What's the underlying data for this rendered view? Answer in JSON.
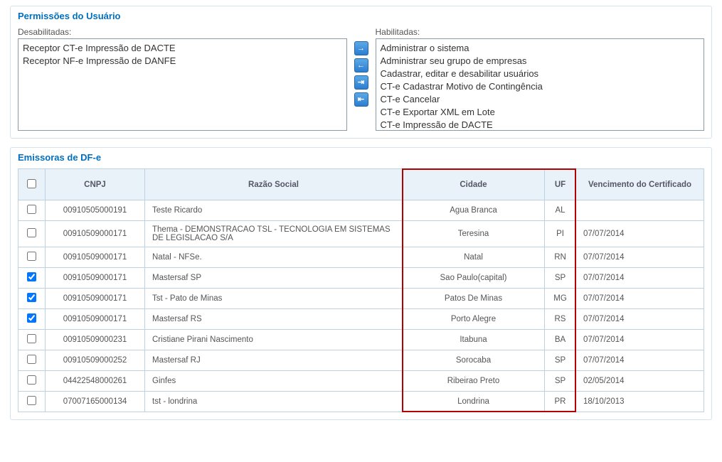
{
  "permissions": {
    "title": "Permissões do Usuário",
    "disabled_label": "Desabilitadas:",
    "enabled_label": "Habilitadas:",
    "disabled_items": [
      "Receptor CT-e Impressão de DACTE",
      "Receptor NF-e Impressão de DANFE"
    ],
    "enabled_items": [
      "Administrar o sistema",
      "Administrar seu grupo de empresas",
      "Cadastrar, editar e desabilitar usuários",
      "CT-e Cadastrar Motivo de Contingência",
      "CT-e Cancelar",
      "CT-e Exportar XML em Lote",
      "CT-e Impressão de DACTE"
    ],
    "arrows": {
      "right": "→",
      "left": "←",
      "right_all": "⇥",
      "left_all": "⇤"
    }
  },
  "emitters": {
    "title": "Emissoras de DF-e",
    "headers": {
      "cnpj": "CNPJ",
      "razao": "Razão Social",
      "cidade": "Cidade",
      "uf": "UF",
      "venc": "Vencimento do Certificado"
    },
    "rows": [
      {
        "checked": false,
        "cnpj": "00910505000191",
        "razao": "Teste Ricardo",
        "cidade": "Agua Branca",
        "uf": "AL",
        "venc": ""
      },
      {
        "checked": false,
        "cnpj": "00910509000171",
        "razao": "Thema - DEMONSTRACAO TSL - TECNOLOGIA EM SISTEMAS DE LEGISLACAO S/A",
        "cidade": "Teresina",
        "uf": "PI",
        "venc": "07/07/2014"
      },
      {
        "checked": false,
        "cnpj": "00910509000171",
        "razao": "Natal - NFSe.",
        "cidade": "Natal",
        "uf": "RN",
        "venc": "07/07/2014"
      },
      {
        "checked": true,
        "cnpj": "00910509000171",
        "razao": "Mastersaf SP",
        "cidade": "Sao Paulo(capital)",
        "uf": "SP",
        "venc": "07/07/2014"
      },
      {
        "checked": true,
        "cnpj": "00910509000171",
        "razao": "Tst - Pato de Minas",
        "cidade": "Patos De Minas",
        "uf": "MG",
        "venc": "07/07/2014"
      },
      {
        "checked": true,
        "cnpj": "00910509000171",
        "razao": "Mastersaf RS",
        "cidade": "Porto Alegre",
        "uf": "RS",
        "venc": "07/07/2014"
      },
      {
        "checked": false,
        "cnpj": "00910509000231",
        "razao": "Cristiane Pirani Nascimento",
        "cidade": "Itabuna",
        "uf": "BA",
        "venc": "07/07/2014"
      },
      {
        "checked": false,
        "cnpj": "00910509000252",
        "razao": "Mastersaf RJ",
        "cidade": "Sorocaba",
        "uf": "SP",
        "venc": "07/07/2014"
      },
      {
        "checked": false,
        "cnpj": "04422548000261",
        "razao": "Ginfes",
        "cidade": "Ribeirao Preto",
        "uf": "SP",
        "venc": "02/05/2014"
      },
      {
        "checked": false,
        "cnpj": "07007165000134",
        "razao": "tst - londrina",
        "cidade": "Londrina",
        "uf": "PR",
        "venc": "18/10/2013"
      }
    ]
  }
}
